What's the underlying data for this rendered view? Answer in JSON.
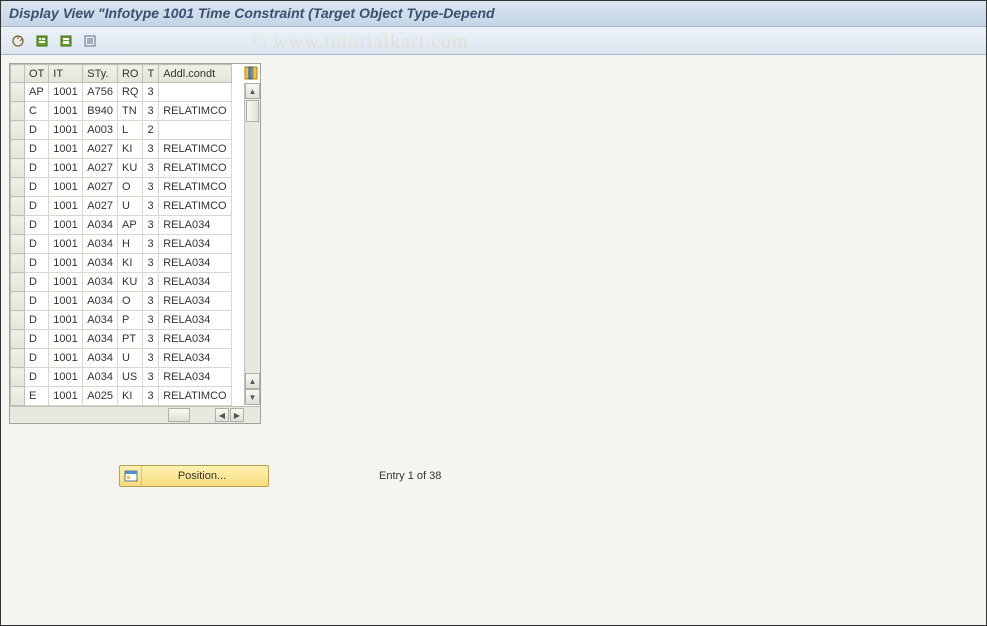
{
  "title": "Display View \"Infotype 1001 Time Constraint (Target Object Type-Depend",
  "watermark": "© www.tutorialkart.com",
  "toolbar": {
    "icons": [
      "toggle-tool-icon",
      "copy-icon",
      "save-icon",
      "print-icon"
    ]
  },
  "columns": {
    "sel": "",
    "ot": "OT",
    "it": "IT",
    "sty": "STy.",
    "ro": "RO",
    "t": "T",
    "addl": "Addl.condt"
  },
  "rows": [
    {
      "ot": "AP",
      "it": "1001",
      "sty": "A756",
      "ro": "RQ",
      "t": "3",
      "addl": ""
    },
    {
      "ot": "C",
      "it": "1001",
      "sty": "B940",
      "ro": "TN",
      "t": "3",
      "addl": "RELATIMCO"
    },
    {
      "ot": "D",
      "it": "1001",
      "sty": "A003",
      "ro": "L",
      "t": "2",
      "addl": ""
    },
    {
      "ot": "D",
      "it": "1001",
      "sty": "A027",
      "ro": "KI",
      "t": "3",
      "addl": "RELATIMCO"
    },
    {
      "ot": "D",
      "it": "1001",
      "sty": "A027",
      "ro": "KU",
      "t": "3",
      "addl": "RELATIMCO"
    },
    {
      "ot": "D",
      "it": "1001",
      "sty": "A027",
      "ro": "O",
      "t": "3",
      "addl": "RELATIMCO"
    },
    {
      "ot": "D",
      "it": "1001",
      "sty": "A027",
      "ro": "U",
      "t": "3",
      "addl": "RELATIMCO"
    },
    {
      "ot": "D",
      "it": "1001",
      "sty": "A034",
      "ro": "AP",
      "t": "3",
      "addl": "RELA034"
    },
    {
      "ot": "D",
      "it": "1001",
      "sty": "A034",
      "ro": "H",
      "t": "3",
      "addl": "RELA034"
    },
    {
      "ot": "D",
      "it": "1001",
      "sty": "A034",
      "ro": "KI",
      "t": "3",
      "addl": "RELA034"
    },
    {
      "ot": "D",
      "it": "1001",
      "sty": "A034",
      "ro": "KU",
      "t": "3",
      "addl": "RELA034"
    },
    {
      "ot": "D",
      "it": "1001",
      "sty": "A034",
      "ro": "O",
      "t": "3",
      "addl": "RELA034"
    },
    {
      "ot": "D",
      "it": "1001",
      "sty": "A034",
      "ro": "P",
      "t": "3",
      "addl": "RELA034"
    },
    {
      "ot": "D",
      "it": "1001",
      "sty": "A034",
      "ro": "PT",
      "t": "3",
      "addl": "RELA034"
    },
    {
      "ot": "D",
      "it": "1001",
      "sty": "A034",
      "ro": "U",
      "t": "3",
      "addl": "RELA034"
    },
    {
      "ot": "D",
      "it": "1001",
      "sty": "A034",
      "ro": "US",
      "t": "3",
      "addl": "RELA034"
    },
    {
      "ot": "E",
      "it": "1001",
      "sty": "A025",
      "ro": "KI",
      "t": "3",
      "addl": "RELATIMCO"
    }
  ],
  "footer": {
    "position_label": "Position...",
    "entry_text": "Entry 1 of 38"
  }
}
